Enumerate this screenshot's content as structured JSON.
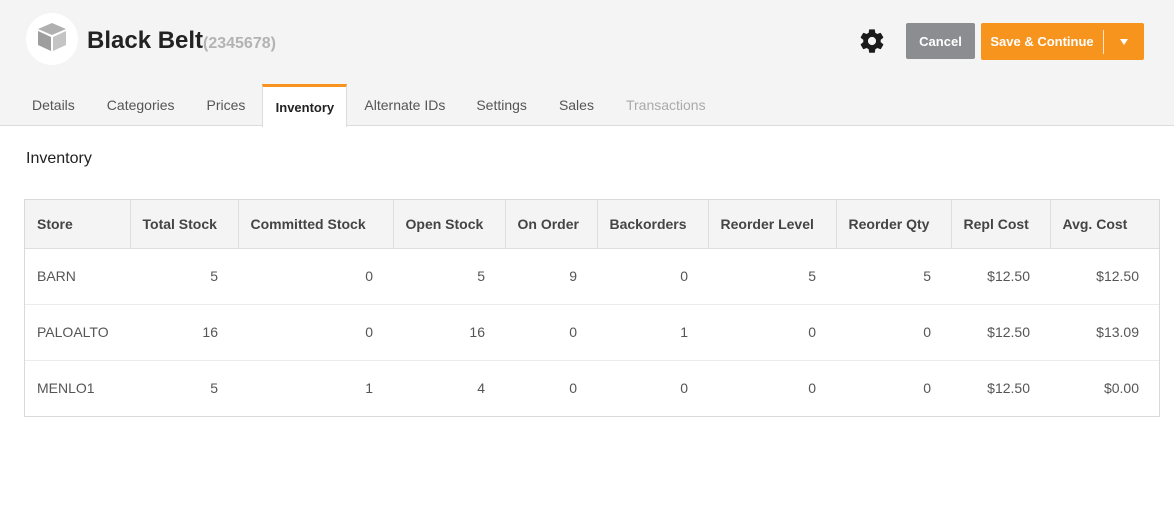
{
  "header": {
    "title": "Black Belt",
    "product_id": "(2345678)",
    "avatar_icon": "box-icon",
    "settings_icon": "gear-icon",
    "cancel_label": "Cancel",
    "save_label": "Save & Continue",
    "save_menu_icon": "caret-down-icon"
  },
  "colors": {
    "accent": "#f7941d",
    "cancel": "#8c8d90",
    "header_bg": "#f5f4f5"
  },
  "tabs": [
    {
      "label": "Details",
      "state": "normal"
    },
    {
      "label": "Categories",
      "state": "normal"
    },
    {
      "label": "Prices",
      "state": "normal"
    },
    {
      "label": "Inventory",
      "state": "active"
    },
    {
      "label": "Alternate IDs",
      "state": "normal"
    },
    {
      "label": "Settings",
      "state": "normal"
    },
    {
      "label": "Sales",
      "state": "normal"
    },
    {
      "label": "Transactions",
      "state": "disabled"
    }
  ],
  "inventory": {
    "section_title": "Inventory",
    "columns": [
      "Store",
      "Total Stock",
      "Committed Stock",
      "Open Stock",
      "On Order",
      "Backorders",
      "Reorder Level",
      "Reorder Qty",
      "Repl Cost",
      "Avg. Cost"
    ],
    "rows": [
      [
        "BARN",
        "5",
        "0",
        "5",
        "9",
        "0",
        "5",
        "5",
        "$12.50",
        "$12.50"
      ],
      [
        "PALOALTO",
        "16",
        "0",
        "16",
        "0",
        "1",
        "0",
        "0",
        "$12.50",
        "$13.09"
      ],
      [
        "MENLO1",
        "5",
        "1",
        "4",
        "0",
        "0",
        "0",
        "0",
        "$12.50",
        "$0.00"
      ]
    ]
  }
}
